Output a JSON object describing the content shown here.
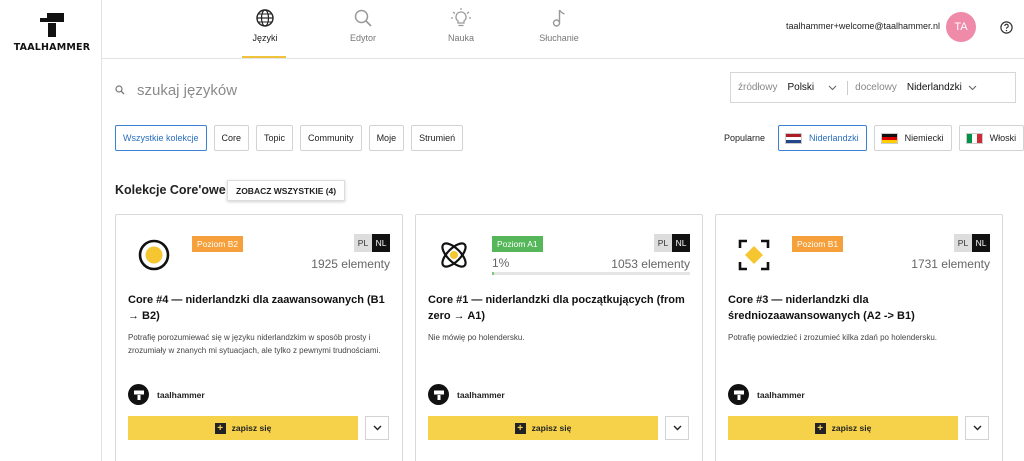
{
  "brand": {
    "name": "TAALHAMMER"
  },
  "nav": [
    {
      "label": "Języki",
      "icon": "globe-icon",
      "active": true
    },
    {
      "label": "Edytor",
      "icon": "search-icon",
      "active": false
    },
    {
      "label": "Nauka",
      "icon": "lightbulb-icon",
      "active": false
    },
    {
      "label": "Słuchanie",
      "icon": "music-note-icon",
      "active": false
    }
  ],
  "user": {
    "email": "taalhammer+welcome@taalhammer.nl",
    "initials": "TA",
    "avatar_color": "#f08aa9"
  },
  "search": {
    "placeholder": "szukaj języków"
  },
  "language_selector": {
    "source_label": "źródłowy",
    "source_value": "Polski",
    "target_label": "docelowy",
    "target_value": "Niderlandzki"
  },
  "filters": [
    "Wszystkie kolekcje",
    "Core",
    "Topic",
    "Community",
    "Moje",
    "Strumień"
  ],
  "popular": {
    "label": "Popularne",
    "languages": [
      {
        "name": "Niderlandzki",
        "active": true
      },
      {
        "name": "Niemiecki",
        "active": false
      },
      {
        "name": "Włoski",
        "active": false
      }
    ]
  },
  "section": {
    "title": "Kolekcje Core'owe",
    "see_all": "ZOBACZ WSZYSTKIE (4)"
  },
  "cards": [
    {
      "icon": "sun-circle-icon",
      "level": "Poziom B2",
      "level_color": "#f5a03a",
      "src": "PL",
      "tgt": "NL",
      "count": "1925 elementy",
      "title": "Core #4 — niderlandzki dla zaawansowanych (B1 → B2)",
      "description": "Potrafię porozumiewać się w języku niderlandzkim w sposób prosty i zrozumiały w znanych mi sytuacjach, ale tylko z pewnymi trudnościami.",
      "author": "taalhammer",
      "subscribe": "zapisz się"
    },
    {
      "icon": "atom-icon",
      "level": "Poziom A1",
      "level_color": "#55b75a",
      "src": "PL",
      "tgt": "NL",
      "progress": "1%",
      "progress_value": 0.01,
      "count": "1053 elementy",
      "title": "Core #1 — niderlandzki dla początkujących (from zero → A1)",
      "description": "Nie mówię po holendersku.",
      "author": "taalhammer",
      "subscribe": "zapisz się"
    },
    {
      "icon": "focus-target-icon",
      "level": "Poziom B1",
      "level_color": "#f5a03a",
      "src": "PL",
      "tgt": "NL",
      "count": "1731 elementy",
      "title": "Core #3 — niderlandzki dla średniozaawansowanych (A2 -> B1)",
      "description": "Potrafię powiedzieć i zrozumieć kilka zdań po holendersku.",
      "author": "taalhammer",
      "subscribe": "zapisz się"
    }
  ],
  "colors": {
    "accent": "#f6d24a",
    "nav_underline": "#f0c43a",
    "active_chip": "#3b82d6"
  }
}
